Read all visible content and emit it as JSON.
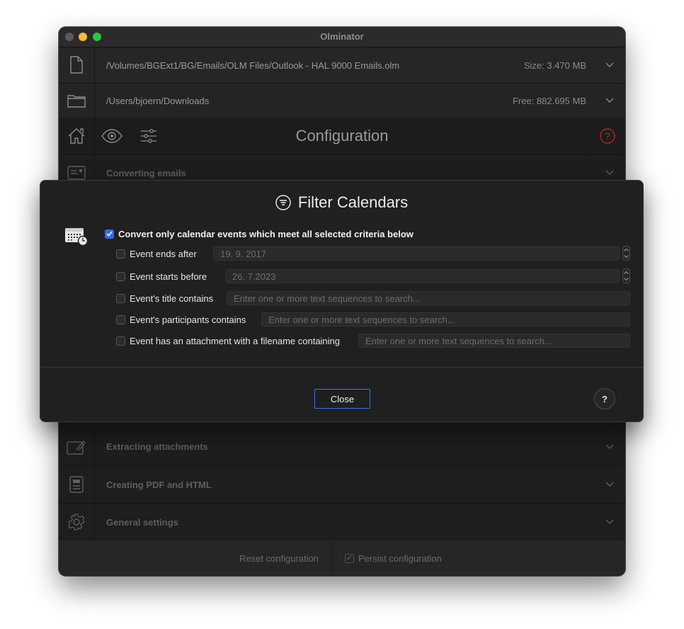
{
  "window": {
    "title": "Olminator"
  },
  "source": {
    "path": "/Volumes/BGExt1/BG/Emails/OLM Files/Outlook - HAL 9000 Emails.olm",
    "size": "Size: 3.470 MB"
  },
  "target": {
    "path": "/Users/bjoern/Downloads",
    "free": "Free: 882.695 MB"
  },
  "toolbar": {
    "title": "Configuration"
  },
  "sections": [
    {
      "label": "Converting emails",
      "icon": "email-card-icon"
    },
    {
      "label": "Extracting attachments",
      "icon": "attachment-icon"
    },
    {
      "label": "Creating PDF and HTML",
      "icon": "document-icon"
    },
    {
      "label": "General settings",
      "icon": "gear-icon"
    }
  ],
  "footer": {
    "reset": "Reset configuration",
    "persist": "Persist configuration"
  },
  "dialog": {
    "title": "Filter Calendars",
    "main_criteria": "Convert only calendar events which meet all selected criteria below",
    "criteria": [
      {
        "label": "Event ends after",
        "value": "19. 9. 2017"
      },
      {
        "label": "Event starts before",
        "value": "26. 7.2023"
      },
      {
        "label": "Event's title contains",
        "placeholder": "Enter one or more text sequences to search..."
      },
      {
        "label": "Event's participants contains",
        "placeholder": "Enter one or more text sequences to search..."
      },
      {
        "label": "Event has an attachment with a filename containing",
        "placeholder": "Enter one or more text sequences to search..."
      }
    ],
    "close_label": "Close",
    "help_label": "?"
  },
  "colors": {
    "accent": "#2e6df6",
    "help_red": "#b3261e"
  }
}
